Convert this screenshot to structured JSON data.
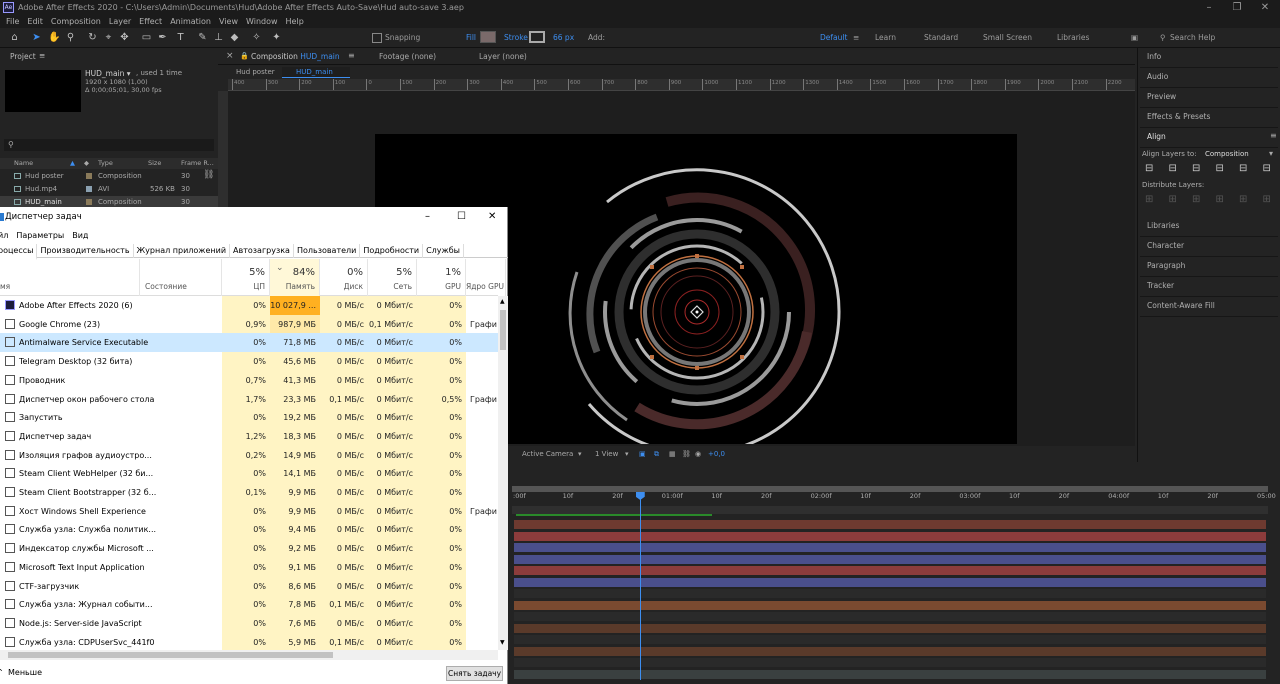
{
  "window_title": "Adobe After Effects 2020 - C:\\Users\\Admin\\Documents\\Hud\\Adobe After Effects Auto-Save\\Hud auto-save 3.aep",
  "menu": [
    "File",
    "Edit",
    "Composition",
    "Layer",
    "Effect",
    "Animation",
    "View",
    "Window",
    "Help"
  ],
  "toolbar": {
    "snapping": "Snapping",
    "fill": "Fill",
    "stroke": "Stroke",
    "stroke_width": "66 px",
    "add": "Add:",
    "workspaces": [
      "Default",
      "Learn",
      "Standard",
      "Small Screen",
      "Libraries"
    ],
    "search": "Search Help"
  },
  "project": {
    "tab": "Project",
    "comp_name": "HUD_main ▾",
    "used": ", used 1 time",
    "res": "1920 x 1080 (1,00)",
    "dur": "Δ 0;00;05;01, 30,00 fps",
    "columns": [
      "Name",
      "Type",
      "Size",
      "Frame R..."
    ],
    "items": [
      {
        "name": "Hud poster",
        "type": "Composition",
        "size": "",
        "fr": "30",
        "color": "#8a7a5a"
      },
      {
        "name": "Hud.mp4",
        "type": "AVI",
        "size": "526 KB",
        "fr": "30",
        "color": "#8aa0b0"
      },
      {
        "name": "HUD_main",
        "type": "Composition",
        "size": "",
        "fr": "30",
        "color": "#8a7a5a"
      }
    ]
  },
  "comp": {
    "tab_prefix": "Composition",
    "tab_name": "HUD_main",
    "footage": "Footage (none)",
    "layer": "Layer (none)",
    "sub_tabs": [
      "Hud poster",
      "HUD_main"
    ],
    "ruler": [
      "400",
      "300",
      "200",
      "100",
      "0",
      "100",
      "200",
      "300",
      "400",
      "500",
      "600",
      "700",
      "800",
      "900",
      "1000",
      "1100",
      "1200",
      "1300",
      "1400",
      "1500",
      "1600",
      "1700",
      "1800",
      "1900",
      "2000",
      "2100",
      "2200"
    ],
    "active_camera": "Active Camera",
    "view": "1 View",
    "offset": "+0,0"
  },
  "right_panels": [
    "Info",
    "Audio",
    "Preview",
    "Effects & Presets",
    "Align",
    "Libraries",
    "Character",
    "Paragraph",
    "Tracker",
    "Content-Aware Fill"
  ],
  "align": {
    "align_to_label": "Align Layers to:",
    "align_to": "Composition",
    "distribute": "Distribute Layers:"
  },
  "timeline": {
    "ruler": [
      ":00f",
      "10f",
      "20f",
      "01:00f",
      "10f",
      "20f",
      "02:00f",
      "10f",
      "20f",
      "03:00f",
      "10f",
      "20f",
      "04:00f",
      "10f",
      "20f",
      "05:00"
    ],
    "playhead_fraction": 0.169,
    "layer_colors": [
      "#6e3a30",
      "#8c3c3c",
      "#4a4f8c",
      "#4a4f8c",
      "#8c3c3c",
      "#4a4f8c",
      "#2a2a2a",
      "#7a4a30",
      "#2a2a2a",
      "#5a3a2a",
      "#2a2a2a",
      "#5a3a2a",
      "#2a2a2a",
      "#3a4040"
    ]
  },
  "task_manager": {
    "title": "Диспетчер задач",
    "menu": [
      "йл",
      "Параметры",
      "Вид"
    ],
    "tabs": [
      "роцессы",
      "Производительность",
      "Журнал приложений",
      "Автозагрузка",
      "Пользователи",
      "Подробности",
      "Службы"
    ],
    "headers": [
      {
        "pct": "",
        "lbl": "мя"
      },
      {
        "pct": "",
        "lbl": "Состояние"
      },
      {
        "pct": "5%",
        "lbl": "ЦП"
      },
      {
        "pct": "84%",
        "lbl": "Память"
      },
      {
        "pct": "0%",
        "lbl": "Диск"
      },
      {
        "pct": "5%",
        "lbl": "Сеть"
      },
      {
        "pct": "1%",
        "lbl": "GPU"
      },
      {
        "pct": "",
        "lbl": "Ядро GPU"
      }
    ],
    "rows": [
      {
        "name": "Adobe After Effects 2020 (6)",
        "cpu": "0%",
        "mem": "10 027,9 ...",
        "disk": "0 МБ/с",
        "net": "0 Мбит/с",
        "gpu": "0%",
        "eng": ""
      },
      {
        "name": "Google Chrome (23)",
        "cpu": "0,9%",
        "mem": "987,9 МБ",
        "disk": "0 МБ/с",
        "net": "0,1 Мбит/с",
        "gpu": "0%",
        "eng": "Графи"
      },
      {
        "name": "Antimalware Service Executable",
        "cpu": "0%",
        "mem": "71,8 МБ",
        "disk": "0 МБ/с",
        "net": "0 Мбит/с",
        "gpu": "0%",
        "eng": ""
      },
      {
        "name": "Telegram Desktop (32 бита)",
        "cpu": "0%",
        "mem": "45,6 МБ",
        "disk": "0 МБ/с",
        "net": "0 Мбит/с",
        "gpu": "0%",
        "eng": ""
      },
      {
        "name": "Проводник",
        "cpu": "0,7%",
        "mem": "41,3 МБ",
        "disk": "0 МБ/с",
        "net": "0 Мбит/с",
        "gpu": "0%",
        "eng": ""
      },
      {
        "name": "Диспетчер окон рабочего стола",
        "cpu": "1,7%",
        "mem": "23,3 МБ",
        "disk": "0,1 МБ/с",
        "net": "0 Мбит/с",
        "gpu": "0,5%",
        "eng": "Графи"
      },
      {
        "name": "Запустить",
        "cpu": "0%",
        "mem": "19,2 МБ",
        "disk": "0 МБ/с",
        "net": "0 Мбит/с",
        "gpu": "0%",
        "eng": ""
      },
      {
        "name": "Диспетчер задач",
        "cpu": "1,2%",
        "mem": "18,3 МБ",
        "disk": "0 МБ/с",
        "net": "0 Мбит/с",
        "gpu": "0%",
        "eng": ""
      },
      {
        "name": "Изоляция графов аудиоустро...",
        "cpu": "0,2%",
        "mem": "14,9 МБ",
        "disk": "0 МБ/с",
        "net": "0 Мбит/с",
        "gpu": "0%",
        "eng": ""
      },
      {
        "name": "Steam Client WebHelper (32 би...",
        "cpu": "0%",
        "mem": "14,1 МБ",
        "disk": "0 МБ/с",
        "net": "0 Мбит/с",
        "gpu": "0%",
        "eng": ""
      },
      {
        "name": "Steam Client Bootstrapper (32 б...",
        "cpu": "0,1%",
        "mem": "9,9 МБ",
        "disk": "0 МБ/с",
        "net": "0 Мбит/с",
        "gpu": "0%",
        "eng": ""
      },
      {
        "name": "Хост Windows Shell Experience",
        "cpu": "0%",
        "mem": "9,9 МБ",
        "disk": "0 МБ/с",
        "net": "0 Мбит/с",
        "gpu": "0%",
        "eng": "Графи"
      },
      {
        "name": "Служба узла: Служба политик...",
        "cpu": "0%",
        "mem": "9,4 МБ",
        "disk": "0 МБ/с",
        "net": "0 Мбит/с",
        "gpu": "0%",
        "eng": ""
      },
      {
        "name": "Индексатор службы Microsoft ...",
        "cpu": "0%",
        "mem": "9,2 МБ",
        "disk": "0 МБ/с",
        "net": "0 Мбит/с",
        "gpu": "0%",
        "eng": ""
      },
      {
        "name": "Microsoft Text Input Application",
        "cpu": "0%",
        "mem": "9,1 МБ",
        "disk": "0 МБ/с",
        "net": "0 Мбит/с",
        "gpu": "0%",
        "eng": ""
      },
      {
        "name": "CTF-загрузчик",
        "cpu": "0%",
        "mem": "8,6 МБ",
        "disk": "0 МБ/с",
        "net": "0 Мбит/с",
        "gpu": "0%",
        "eng": ""
      },
      {
        "name": "Служба узла: Журнал событи...",
        "cpu": "0%",
        "mem": "7,8 МБ",
        "disk": "0,1 МБ/с",
        "net": "0 Мбит/с",
        "gpu": "0%",
        "eng": ""
      },
      {
        "name": "Node.js: Server-side JavaScript",
        "cpu": "0%",
        "mem": "7,6 МБ",
        "disk": "0 МБ/с",
        "net": "0 Мбит/с",
        "gpu": "0%",
        "eng": ""
      },
      {
        "name": "Служба узла: CDPUserSvc_441f0",
        "cpu": "0%",
        "mem": "5,9 МБ",
        "disk": "0,1 МБ/с",
        "net": "0 Мбит/с",
        "gpu": "0%",
        "eng": ""
      }
    ],
    "less": "Меньше",
    "end_task": "Снять задачу"
  }
}
